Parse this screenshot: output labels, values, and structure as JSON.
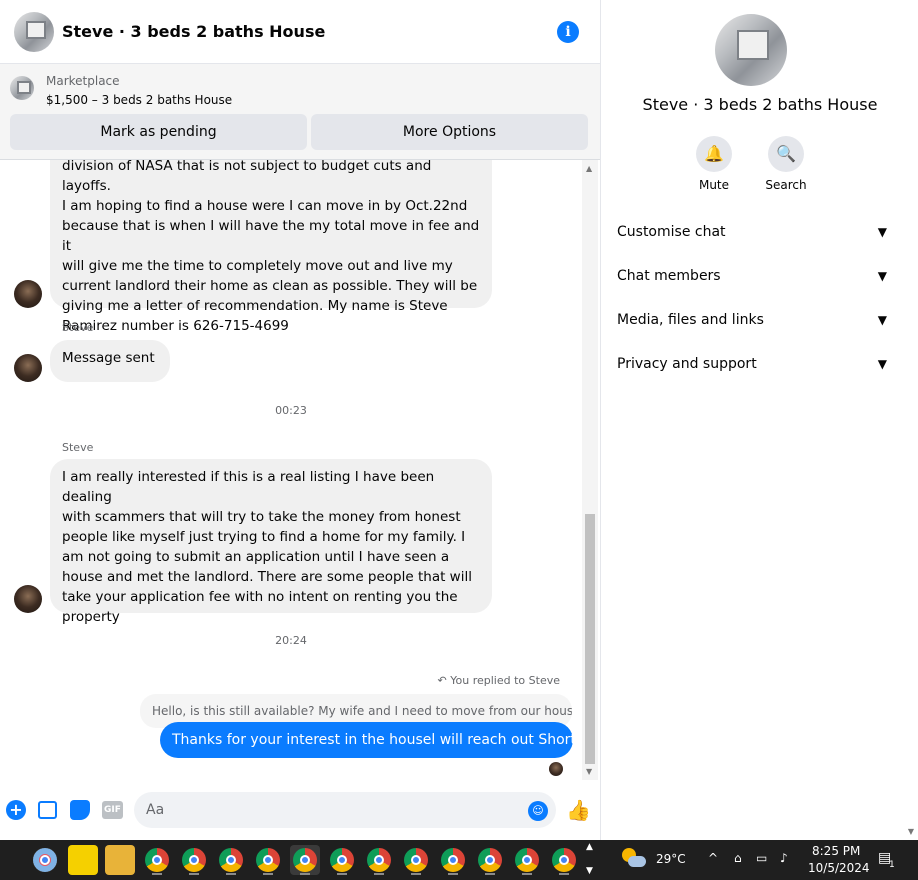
{
  "chat": {
    "header": {
      "title": "Steve · 3 beds 2 baths House",
      "info_icon": "i"
    },
    "marketplace": {
      "label": "Marketplace",
      "title": "$1,500 – 3 beds 2 baths House",
      "pending_button": "Mark as pending",
      "more_button": "More Options"
    },
    "messages": {
      "m1_lines": [
        "division of NASA that is not subject to budget cuts and layoffs.",
        "I am hoping to find a house were I can move in by Oct.22nd",
        "because that is when I will have the my total move in fee and it",
        "will give me the time to completely move out and live my",
        "current landlord their home as clean as possible. They will be",
        "giving me a letter of recommendation. My name is Steve",
        "Ramirez number is 626-715-4699"
      ],
      "sender_1": "Steve",
      "m2": "Message sent",
      "time_1": "00:23",
      "sender_2": "Steve",
      "m3_lines": [
        "I am really interested if this is a real listing I have been dealing",
        "with scammers that will try to take the money from honest",
        "people like myself just trying to find a home for  my family. I",
        "am not going to submit an application until I have seen a",
        "house and met the landlord. There are some people that will",
        "take your application fee with no intent on renting you the",
        "property"
      ],
      "time_2": "20:24",
      "reply_note": "You replied to Steve",
      "quoted": "Hello, is this still available? My wife and I need to move from our hous...",
      "mine": "Thanks for your interest in the housel will reach out Shortly"
    },
    "composer": {
      "placeholder": "Aa",
      "gif_label": "GIF"
    }
  },
  "info": {
    "title": "Steve · 3 beds 2 baths House",
    "actions": {
      "mute": "Mute",
      "search": "Search"
    },
    "sections": [
      "Customise chat",
      "Chat members",
      "Media, files and links",
      "Privacy and support"
    ]
  },
  "taskbar": {
    "temperature": "29°C",
    "time": "8:25 PM",
    "date": "10/5/2024",
    "notification_count": "1"
  },
  "colors": {
    "accent": "#0a7cff",
    "bubble": "#f0f0f0",
    "taskbar": "#1f1f1f"
  }
}
